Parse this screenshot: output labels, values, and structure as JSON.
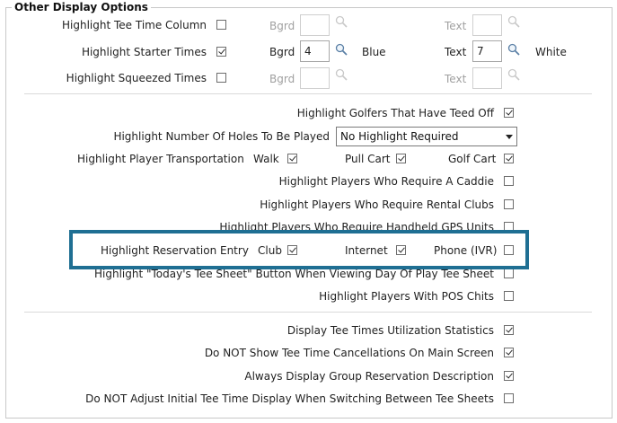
{
  "section_title": "Other Display Options",
  "rows": {
    "tee_time_column": {
      "label": "Highlight Tee Time Column",
      "checked": false,
      "bgrd_label": "Bgrd",
      "bgrd_value": "",
      "text_label": "Text",
      "text_value": ""
    },
    "starter_times": {
      "label": "Highlight Starter Times",
      "checked": true,
      "bgrd_label": "Bgrd",
      "bgrd_value": "4",
      "bgrd_color_name": "Blue",
      "text_label": "Text",
      "text_value": "7",
      "text_color_name": "White"
    },
    "squeezed_times": {
      "label": "Highlight Squeezed Times",
      "checked": false,
      "bgrd_label": "Bgrd",
      "bgrd_value": "",
      "text_label": "Text",
      "text_value": ""
    },
    "golfers_teed_off": {
      "label": "Highlight Golfers That Have Teed Off",
      "checked": true
    },
    "holes_to_play": {
      "label": "Highlight Number Of Holes To Be Played",
      "selected": "No Highlight Required"
    },
    "transportation": {
      "label": "Highlight Player Transportation",
      "walk_label": "Walk",
      "walk": true,
      "pull_cart_label": "Pull Cart",
      "pull_cart": true,
      "golf_cart_label": "Golf Cart",
      "golf_cart": true
    },
    "caddie": {
      "label": "Highlight Players Who Require A Caddie",
      "checked": false
    },
    "rental_clubs": {
      "label": "Highlight Players Who Require Rental Clubs",
      "checked": false
    },
    "gps_units": {
      "label": "Highlight Players Who Require Handheld GPS Units",
      "checked": false
    },
    "reservation_entry": {
      "label": "Highlight Reservation Entry",
      "club_label": "Club",
      "club": true,
      "internet_label": "Internet",
      "internet": true,
      "phone_label": "Phone (IVR)",
      "phone": false
    },
    "todays_tee_sheet": {
      "label": "Highlight \"Today's Tee Sheet\" Button When Viewing Day Of Play Tee Sheet",
      "checked": false
    },
    "pos_chits": {
      "label": "Highlight Players With POS Chits",
      "checked": false
    },
    "utilization_stats": {
      "label": "Display Tee Times Utilization Statistics",
      "checked": true
    },
    "no_cancellations": {
      "label": "Do NOT Show Tee Time Cancellations On Main Screen",
      "checked": true
    },
    "group_description": {
      "label": "Always Display Group Reservation Description",
      "checked": true
    },
    "no_adjust_display": {
      "label": "Do NOT Adjust Initial Tee Time Display When Switching Between Tee Sheets",
      "checked": false
    }
  },
  "colors": {
    "highlight_box": "#1f6f93",
    "disabled_text": "#a0a0a0"
  }
}
